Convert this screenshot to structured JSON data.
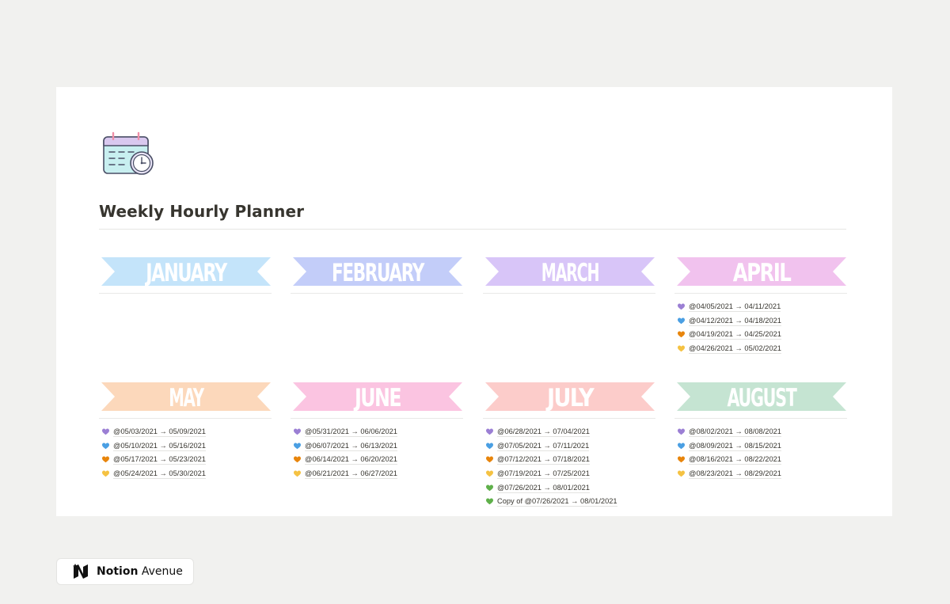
{
  "page": {
    "title": "Weekly Hourly Planner",
    "icon": "calendar-clock-icon"
  },
  "months": [
    {
      "name": "JANUARY",
      "color": "#c4e4fa",
      "weeks": []
    },
    {
      "name": "FEBRUARY",
      "color": "#c3cdf9",
      "weeks": []
    },
    {
      "name": "MARCH",
      "color": "#d8c5f8",
      "weeks": []
    },
    {
      "name": "APRIL",
      "color": "#f1c2ee",
      "weeks": [
        {
          "label": "@04/05/2021 → 04/11/2021",
          "heart": "purple"
        },
        {
          "label": "@04/12/2021 → 04/18/2021",
          "heart": "blue"
        },
        {
          "label": "@04/19/2021 → 04/25/2021",
          "heart": "orange"
        },
        {
          "label": "@04/26/2021 → 05/02/2021",
          "heart": "yellow"
        }
      ]
    },
    {
      "name": "MAY",
      "color": "#fcd8bb",
      "weeks": [
        {
          "label": "@05/03/2021 → 05/09/2021",
          "heart": "purple"
        },
        {
          "label": "@05/10/2021 → 05/16/2021",
          "heart": "blue"
        },
        {
          "label": "@05/17/2021 → 05/23/2021",
          "heart": "orange"
        },
        {
          "label": "@05/24/2021 → 05/30/2021",
          "heart": "yellow"
        }
      ]
    },
    {
      "name": "JUNE",
      "color": "#fbc4e1",
      "weeks": [
        {
          "label": "@05/31/2021 → 06/06/2021",
          "heart": "purple"
        },
        {
          "label": "@06/07/2021 → 06/13/2021",
          "heart": "blue"
        },
        {
          "label": "@06/14/2021 → 06/20/2021",
          "heart": "orange"
        },
        {
          "label": "@06/21/2021 → 06/27/2021",
          "heart": "yellow"
        }
      ]
    },
    {
      "name": "JULY",
      "color": "#fcccca",
      "weeks": [
        {
          "label": "@06/28/2021 → 07/04/2021",
          "heart": "purple"
        },
        {
          "label": "@07/05/2021 → 07/11/2021",
          "heart": "blue"
        },
        {
          "label": "@07/12/2021 → 07/18/2021",
          "heart": "orange"
        },
        {
          "label": "@07/19/2021 → 07/25/2021",
          "heart": "yellow"
        },
        {
          "label": "@07/26/2021 → 08/01/2021",
          "heart": "green"
        },
        {
          "label": "Copy of @07/26/2021 → 08/01/2021",
          "heart": "green"
        }
      ]
    },
    {
      "name": "AUGUST",
      "color": "#c5e4d2",
      "weeks": [
        {
          "label": "@08/02/2021 → 08/08/2021",
          "heart": "purple"
        },
        {
          "label": "@08/09/2021 → 08/15/2021",
          "heart": "blue"
        },
        {
          "label": "@08/16/2021 → 08/22/2021",
          "heart": "orange"
        },
        {
          "label": "@08/23/2021 → 08/29/2021",
          "heart": "yellow"
        }
      ]
    }
  ],
  "heart_colors": {
    "purple": "#9b7fd4",
    "blue": "#4a9fe3",
    "orange": "#e8850c",
    "yellow": "#f5c242",
    "green": "#5fb04a"
  },
  "footer": {
    "brand": "Notion",
    "suffix": " Avenue",
    "icon": "notion-avenue-logo-icon"
  }
}
